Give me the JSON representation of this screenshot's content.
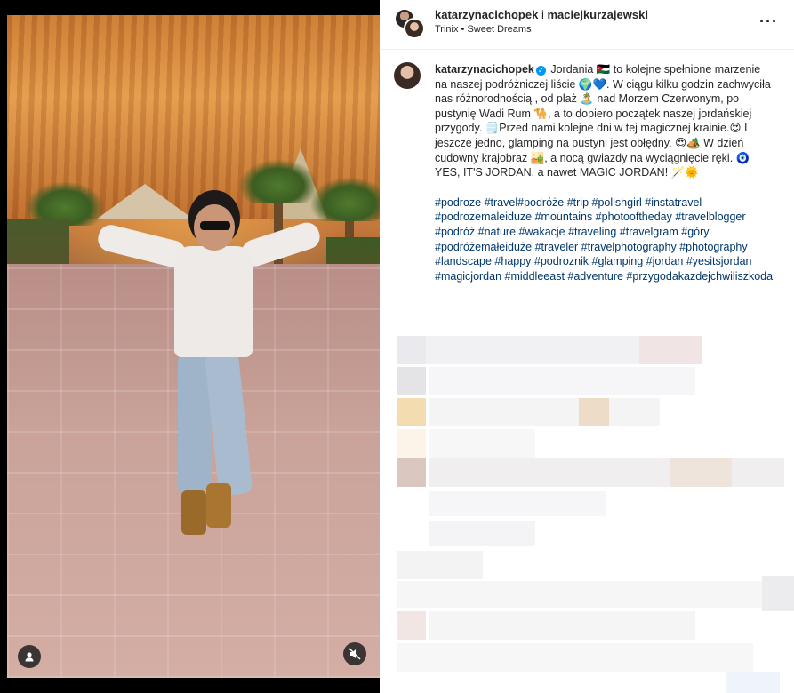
{
  "post": {
    "header": {
      "user1": "katarzynacichopek",
      "separator": "i",
      "user2": "maciejkurzajewski",
      "audio": "Trinix • Sweet Dreams",
      "more_icon": "more-horizontal-icon"
    },
    "caption": {
      "username": "katarzynacichopek",
      "verified_icon": "verified-badge-icon",
      "text": "Jordania 🇯🇴 to kolejne spełnione marzenie na naszej podróżniczej liście 🌍💙. W ciągu kilku godzin zachwyciła nas różnorodnością , od plaż 🏝️ nad Morzem Czerwonym, po pustynię Wadi Rum 🐪, a to dopiero początek naszej jordańskiej przygody. 🗒️Przed nami kolejne dni w tej magicznej krainie.😍 I jeszcze jedno, glamping na pustyni jest obłędny. 😍🏕️ W dzień cudowny krajobraz 🏜️, a nocą gwiazdy na wyciągnięcie ręki. 🧿 YES, IT'S JORDAN, a nawet MAGIC JORDAN! 🪄🌞",
      "hashtags": "#podroze #travel#podróże #trip #polishgirl #instatravel #podrozemaleiduze #mountains #photooftheday #travelblogger #podróż #nature #wakacje #traveling #travelgram #góry #podróżemałeiduże #traveler #travelphotography #photography #landscape #happy #podroznik #glamping #jordan #yesitsjordan #magicjordan #middleeast #adventure #przygodakazdejchwiliszkoda"
    },
    "media": {
      "user_icon": "user-tag-icon",
      "mute_icon": "mute-icon"
    }
  }
}
